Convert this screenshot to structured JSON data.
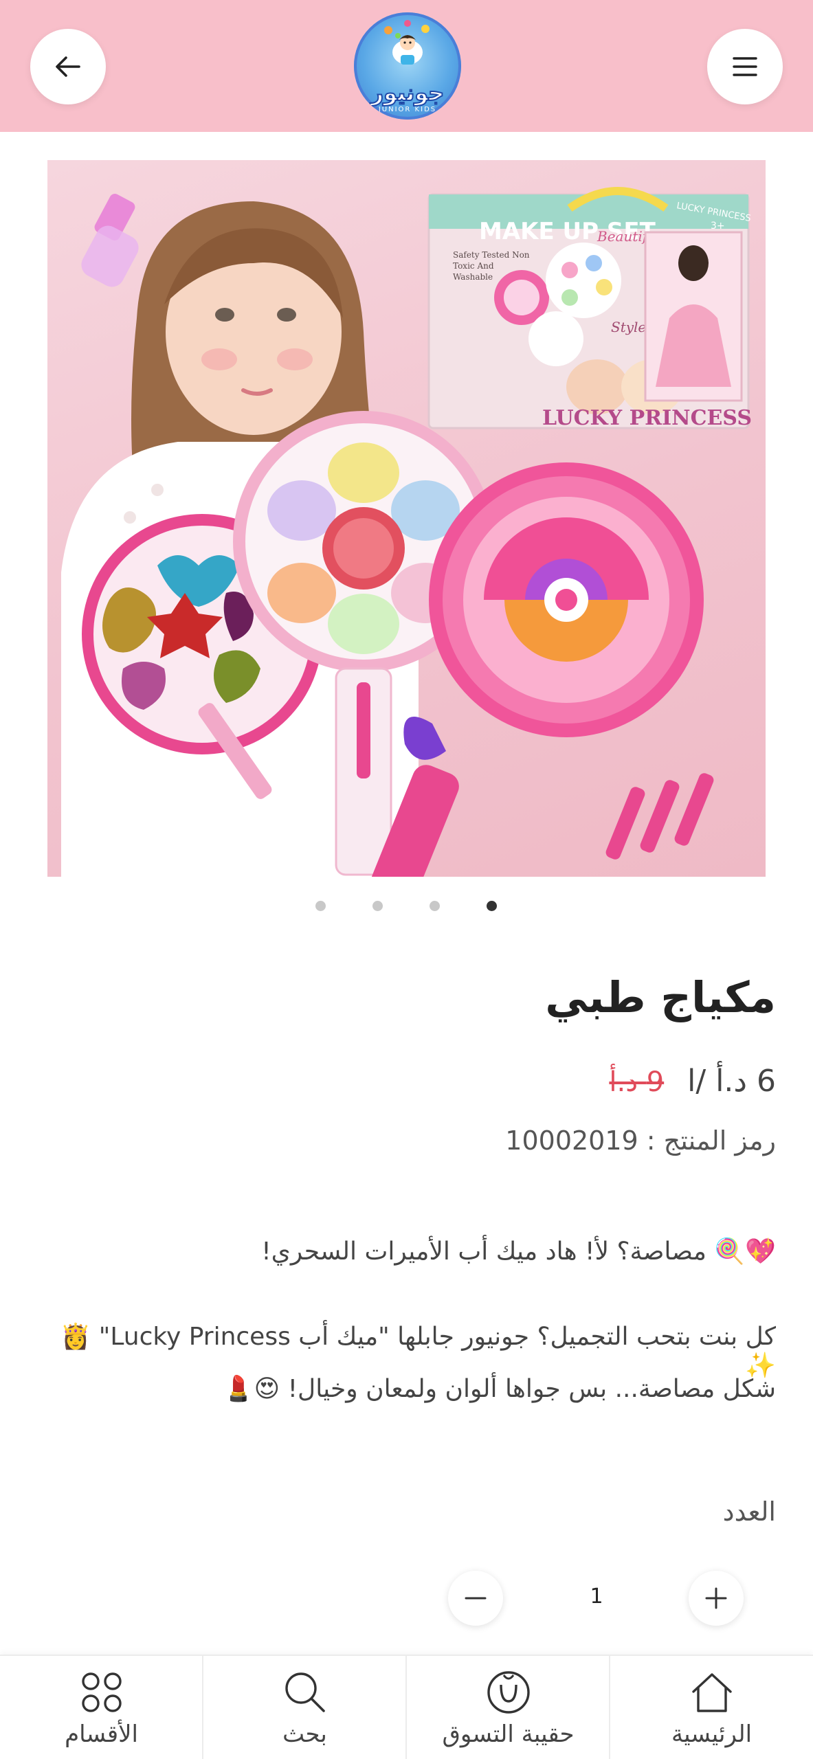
{
  "header": {
    "logo_text": "جونيور",
    "logo_subtext": "JUNIOR KIDS"
  },
  "product": {
    "title": "مكياج طبي",
    "old_price": "9 د.أ",
    "price": "6 د.أ /ا",
    "sku": "رمز المنتج : 10002019",
    "image_text": {
      "box_title": "MAKE UP SET",
      "box_script": "Beautiful",
      "box_brand": "LUCKY PRINCESS",
      "box_side": "LUCKY PRINCESS",
      "box_age": "3+",
      "box_safety": "Safety Tested Non Toxic And Washable",
      "box_style": "Style!"
    },
    "image_count": 4,
    "active_image_index": 3,
    "description": [
      "💖🍭 مصاصة؟ لأ! هاد ميك أب الأميرات السحري!",
      "كل بنت بتحب التجميل؟ جونيور جابلها \"ميك أب Lucky Princess\" 👸✨",
      "شكل مصاصة... بس جواها ألوان ولمعان وخيال! 😍💄"
    ],
    "quantity_label": "العدد",
    "quantity": "1"
  },
  "bottom_nav": [
    {
      "label": "الرئيسية",
      "icon": "home-icon"
    },
    {
      "label": "حقيبة التسوق",
      "icon": "shopping-bag-icon"
    },
    {
      "label": "بحث",
      "icon": "search-icon"
    },
    {
      "label": "الأقسام",
      "icon": "categories-grid-icon"
    }
  ],
  "colors": {
    "header_bg": "#f8bfca",
    "old_price": "#e04b5a",
    "accent_pink": "#e8488f"
  }
}
